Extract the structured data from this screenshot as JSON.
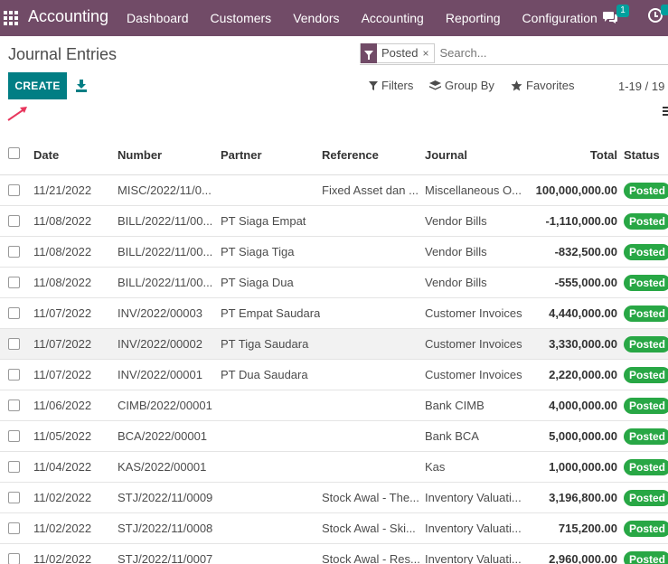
{
  "navbar": {
    "brand": "Accounting",
    "menu": [
      "Dashboard",
      "Customers",
      "Vendors",
      "Accounting",
      "Reporting",
      "Configuration"
    ],
    "chat_badge": "1",
    "bg_color": "#714b67"
  },
  "control_panel": {
    "title": "Journal Entries",
    "create_label": "CREATE",
    "facet_label": "Posted",
    "facet_close": "×",
    "search_placeholder": "Search...",
    "filters_label": "Filters",
    "group_by_label": "Group By",
    "favorites_label": "Favorites",
    "pager": "1-19 / 19",
    "accent_color": "#017e84"
  },
  "table": {
    "headers": {
      "date": "Date",
      "number": "Number",
      "partner": "Partner",
      "reference": "Reference",
      "journal": "Journal",
      "total": "Total",
      "status": "Status"
    },
    "rows": [
      {
        "date": "11/21/2022",
        "number": "MISC/2022/11/0...",
        "partner": "",
        "reference": "Fixed Asset dan ...",
        "journal": "Miscellaneous O...",
        "total": "100,000,000.00",
        "status": "Posted"
      },
      {
        "date": "11/08/2022",
        "number": "BILL/2022/11/00...",
        "partner": "PT Siaga Empat",
        "reference": "",
        "journal": "Vendor Bills",
        "total": "-1,110,000.00",
        "status": "Posted"
      },
      {
        "date": "11/08/2022",
        "number": "BILL/2022/11/00...",
        "partner": "PT Siaga Tiga",
        "reference": "",
        "journal": "Vendor Bills",
        "total": "-832,500.00",
        "status": "Posted"
      },
      {
        "date": "11/08/2022",
        "number": "BILL/2022/11/00...",
        "partner": "PT Siaga Dua",
        "reference": "",
        "journal": "Vendor Bills",
        "total": "-555,000.00",
        "status": "Posted"
      },
      {
        "date": "11/07/2022",
        "number": "INV/2022/00003",
        "partner": "PT Empat Saudara",
        "reference": "",
        "journal": "Customer Invoices",
        "total": "4,440,000.00",
        "status": "Posted"
      },
      {
        "date": "11/07/2022",
        "number": "INV/2022/00002",
        "partner": "PT Tiga Saudara",
        "reference": "",
        "journal": "Customer Invoices",
        "total": "3,330,000.00",
        "status": "Posted"
      },
      {
        "date": "11/07/2022",
        "number": "INV/2022/00001",
        "partner": "PT Dua Saudara",
        "reference": "",
        "journal": "Customer Invoices",
        "total": "2,220,000.00",
        "status": "Posted"
      },
      {
        "date": "11/06/2022",
        "number": "CIMB/2022/00001",
        "partner": "",
        "reference": "",
        "journal": "Bank CIMB",
        "total": "4,000,000.00",
        "status": "Posted"
      },
      {
        "date": "11/05/2022",
        "number": "BCA/2022/00001",
        "partner": "",
        "reference": "",
        "journal": "Bank BCA",
        "total": "5,000,000.00",
        "status": "Posted"
      },
      {
        "date": "11/04/2022",
        "number": "KAS/2022/00001",
        "partner": "",
        "reference": "",
        "journal": "Kas",
        "total": "1,000,000.00",
        "status": "Posted"
      },
      {
        "date": "11/02/2022",
        "number": "STJ/2022/11/0009",
        "partner": "",
        "reference": "Stock Awal - The...",
        "journal": "Inventory Valuati...",
        "total": "3,196,800.00",
        "status": "Posted"
      },
      {
        "date": "11/02/2022",
        "number": "STJ/2022/11/0008",
        "partner": "",
        "reference": "Stock Awal - Ski...",
        "journal": "Inventory Valuati...",
        "total": "715,200.00",
        "status": "Posted"
      },
      {
        "date": "11/02/2022",
        "number": "STJ/2022/11/0007",
        "partner": "",
        "reference": "Stock Awal - Res...",
        "journal": "Inventory Valuati...",
        "total": "2,960,000.00",
        "status": "Posted"
      }
    ],
    "status_color": "#28a745"
  }
}
